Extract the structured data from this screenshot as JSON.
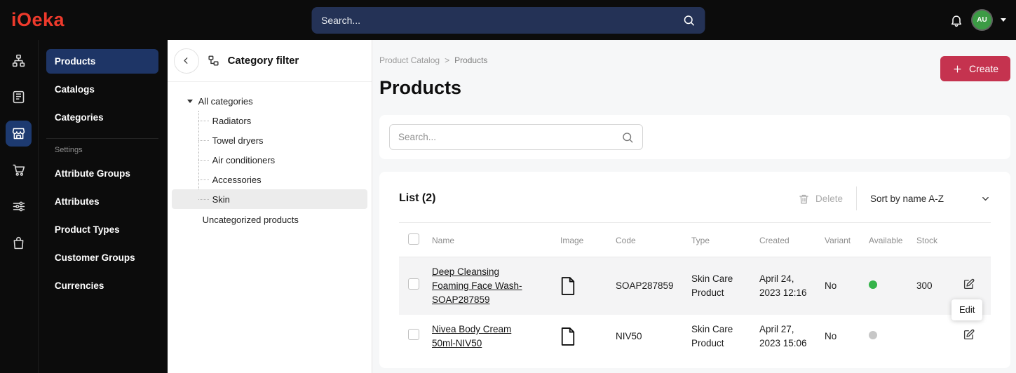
{
  "topbar": {
    "logo_text": "iOeka",
    "search_placeholder": "Search...",
    "avatar_initials": "AU",
    "icons": [
      "bell-icon",
      "avatar",
      "caret-down-icon"
    ]
  },
  "icon_rail": {
    "icons": [
      "sitemap-icon",
      "catalogs-icon",
      "store-icon",
      "cart-icon",
      "attributes-icon",
      "bag-icon"
    ],
    "active": "store-icon"
  },
  "sidebar": {
    "items": [
      {
        "label": "Products",
        "active": true
      },
      {
        "label": "Catalogs",
        "active": false
      },
      {
        "label": "Categories",
        "active": false
      }
    ],
    "section_label": "Settings",
    "settings_items": [
      {
        "label": "Attribute Groups"
      },
      {
        "label": "Attributes"
      },
      {
        "label": "Product Types"
      },
      {
        "label": "Customer Groups"
      },
      {
        "label": "Currencies"
      }
    ]
  },
  "filter": {
    "title": "Category filter",
    "root_label": "All categories",
    "children": [
      {
        "label": "Radiators",
        "selected": false
      },
      {
        "label": "Towel dryers",
        "selected": false
      },
      {
        "label": "Air conditioners",
        "selected": false
      },
      {
        "label": "Accessories",
        "selected": false
      },
      {
        "label": "Skin",
        "selected": true
      }
    ],
    "uncategorized_label": "Uncategorized products"
  },
  "main": {
    "breadcrumb": {
      "parent": "Product Catalog",
      "separator": ">",
      "current": "Products"
    },
    "create_button": "Create",
    "page_title": "Products",
    "search_placeholder": "Search...",
    "list": {
      "title": "List (2)",
      "delete_label": "Delete",
      "sort_label": "Sort by name A-Z"
    },
    "table": {
      "headers": [
        "Name",
        "Image",
        "Code",
        "Type",
        "Created",
        "Variant",
        "Available",
        "Stock"
      ],
      "rows": [
        {
          "name": "Deep Cleansing Foaming Face Wash-SOAP287859",
          "code": "SOAP287859",
          "type": "Skin Care Product",
          "created": "April 24, 2023 12:16",
          "variant": "No",
          "available": "available",
          "stock": "300"
        },
        {
          "name": "Nivea Body Cream 50ml-NIV50",
          "code": "NIV50",
          "type": "Skin Care Product",
          "created": "April 27, 2023 15:06",
          "variant": "No",
          "available": "unavailable",
          "stock": ""
        }
      ]
    },
    "tooltip": "Edit",
    "colors": {
      "accent_red": "#c5334f",
      "available_green": "#35b34a",
      "unavailable_gray": "#c7c7c7",
      "active_nav_blue": "#1e3566"
    }
  }
}
